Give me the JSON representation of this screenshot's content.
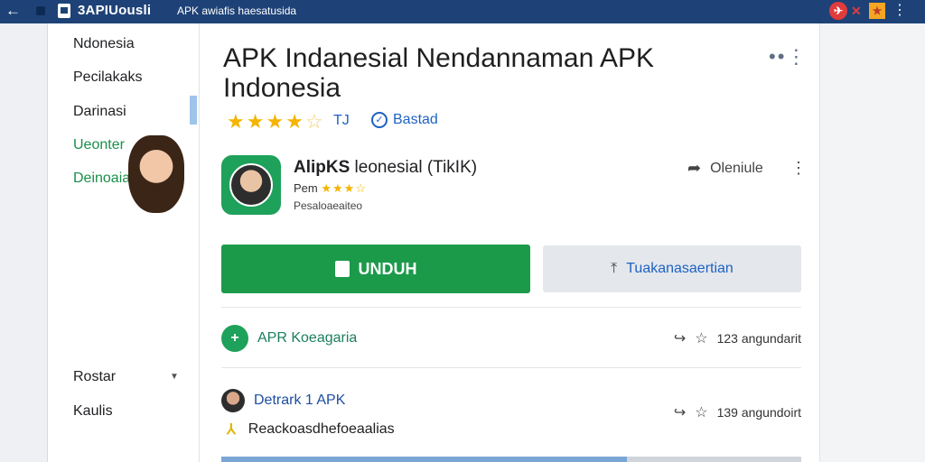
{
  "topbar": {
    "brand": "3APIUousli",
    "url": "APK awiafis haesatusida"
  },
  "sidebar": {
    "items": [
      {
        "label": "Ndonesia"
      },
      {
        "label": "Pecilakaks"
      },
      {
        "label": "Darinasi"
      },
      {
        "label": "Ueonter"
      },
      {
        "label": "Deinoaia"
      },
      {
        "label": "Rostar"
      },
      {
        "label": "Kaulis"
      }
    ]
  },
  "main": {
    "title": "APK Indanesial Nendannaman APK Indonesia",
    "rating_badge": "TJ",
    "verified_label": "Bastad",
    "app": {
      "name_bold": "AlipKS",
      "name_rest": " leonesial (TikIK)",
      "developer": "Pem",
      "meta": "Pesaloaeaiteo",
      "share_label": "Oleniule"
    },
    "install_label": "UNDUH",
    "secondary_label": "Tuakanasaertian",
    "rows": [
      {
        "label": "APR Koeagaria",
        "count": "123 angundarit"
      },
      {
        "label": "Detrark 1 APK",
        "count": "139 angundoirt"
      }
    ],
    "sub_text": "Reackoasdhefoeaalias",
    "progress": 0.7
  },
  "colors": {
    "topbar": "#1e4277",
    "install": "#1b9a4a",
    "accent_blue": "#1e62c4",
    "star": "#f4b400"
  },
  "icons": {
    "back": "back-arrow-icon",
    "star": "star-icon",
    "share": "share-icon",
    "download": "download-icon",
    "kebab": "kebab-menu-icon"
  }
}
